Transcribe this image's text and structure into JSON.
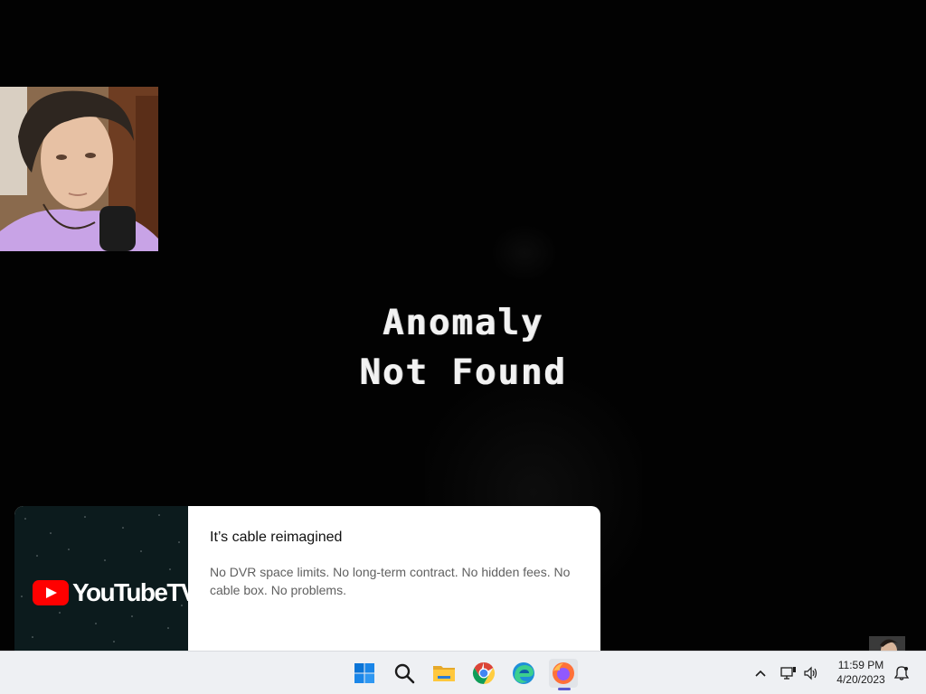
{
  "game": {
    "message_line1": "Anomaly",
    "message_line2": "Not Found"
  },
  "ad": {
    "brand": "YouTubeTV",
    "title": "It’s cable reimagined",
    "body": "No DVR space limits. No long-term contract. No hidden fees. No cable box. No problems."
  },
  "taskbar": {
    "apps": [
      {
        "name": "Start",
        "icon": "windows-start-icon"
      },
      {
        "name": "Search",
        "icon": "search-icon"
      },
      {
        "name": "File Explorer",
        "icon": "folder-icon"
      },
      {
        "name": "Google Chrome",
        "icon": "chrome-icon"
      },
      {
        "name": "Microsoft Edge",
        "icon": "edge-icon"
      },
      {
        "name": "Firefox",
        "icon": "firefox-icon",
        "active": true
      }
    ],
    "tray": {
      "icons": [
        "chevron-up-icon",
        "network-icon",
        "volume-icon",
        "notification-icon"
      ],
      "time": "11:59 PM",
      "date": "4/20/2023"
    }
  },
  "colors": {
    "background": "#000000",
    "youtube_red": "#ff0000",
    "taskbar": "#eef0f3"
  }
}
